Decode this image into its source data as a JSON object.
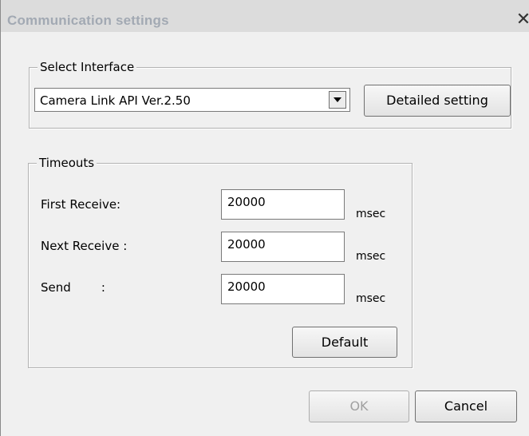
{
  "window": {
    "title": "Communication settings",
    "close_glyph": "✕"
  },
  "interface": {
    "group_label": "Select Interface",
    "selected_value": "Camera Link API Ver.2.50",
    "detailed_button": "Detailed setting"
  },
  "timeouts": {
    "group_label": "Timeouts",
    "rows": [
      {
        "label": "First Receive:",
        "value": "20000",
        "unit": "msec"
      },
      {
        "label": "Next Receive :",
        "value": "20000",
        "unit": "msec"
      },
      {
        "label": "Send        :",
        "value": "20000",
        "unit": "msec"
      }
    ],
    "default_button": "Default"
  },
  "footer": {
    "ok_label": "OK",
    "cancel_label": "Cancel"
  },
  "icons": {
    "close": "close-icon",
    "combo_arrow": "chevron-down-icon"
  },
  "colors": {
    "title_text": "#a2a9b3",
    "disabled_text": "#a0a0a0",
    "window_bg": "#f0f0f0"
  }
}
